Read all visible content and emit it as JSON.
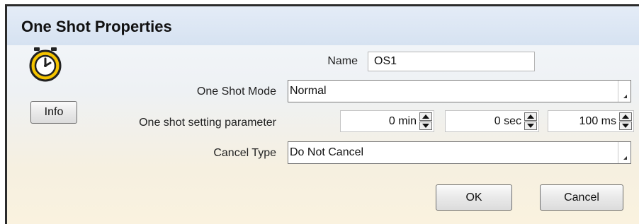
{
  "dialog": {
    "title": "One Shot Properties",
    "info_label": "Info",
    "ok_label": "OK",
    "cancel_label": "Cancel"
  },
  "fields": {
    "name_label": "Name",
    "name_value": "OS1",
    "mode_label": "One Shot Mode",
    "mode_value": "Normal",
    "param_label": "One shot setting parameter",
    "minutes": "0 min",
    "seconds": "0 sec",
    "milliseconds": "100 ms",
    "cancel_type_label": "Cancel Type",
    "cancel_type_value": "Do Not Cancel"
  },
  "colors": {
    "title_bar": "#d6e2f1",
    "timer_yellow": "#f5c400",
    "border_dark": "#2b2b2b"
  },
  "icons": {
    "timer": "stopwatch-icon",
    "combo": "dropdown-arrow-icon",
    "spin_up": "spin-up-arrow-icon",
    "spin_down": "spin-down-arrow-icon"
  }
}
